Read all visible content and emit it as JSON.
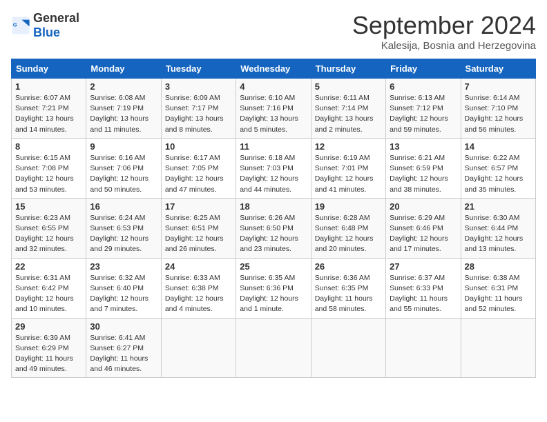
{
  "header": {
    "logo_general": "General",
    "logo_blue": "Blue",
    "month": "September 2024",
    "location": "Kalesija, Bosnia and Herzegovina"
  },
  "weekdays": [
    "Sunday",
    "Monday",
    "Tuesday",
    "Wednesday",
    "Thursday",
    "Friday",
    "Saturday"
  ],
  "weeks": [
    [
      {
        "day": "1",
        "lines": [
          "Sunrise: 6:07 AM",
          "Sunset: 7:21 PM",
          "Daylight: 13 hours",
          "and 14 minutes."
        ]
      },
      {
        "day": "2",
        "lines": [
          "Sunrise: 6:08 AM",
          "Sunset: 7:19 PM",
          "Daylight: 13 hours",
          "and 11 minutes."
        ]
      },
      {
        "day": "3",
        "lines": [
          "Sunrise: 6:09 AM",
          "Sunset: 7:17 PM",
          "Daylight: 13 hours",
          "and 8 minutes."
        ]
      },
      {
        "day": "4",
        "lines": [
          "Sunrise: 6:10 AM",
          "Sunset: 7:16 PM",
          "Daylight: 13 hours",
          "and 5 minutes."
        ]
      },
      {
        "day": "5",
        "lines": [
          "Sunrise: 6:11 AM",
          "Sunset: 7:14 PM",
          "Daylight: 13 hours",
          "and 2 minutes."
        ]
      },
      {
        "day": "6",
        "lines": [
          "Sunrise: 6:13 AM",
          "Sunset: 7:12 PM",
          "Daylight: 12 hours",
          "and 59 minutes."
        ]
      },
      {
        "day": "7",
        "lines": [
          "Sunrise: 6:14 AM",
          "Sunset: 7:10 PM",
          "Daylight: 12 hours",
          "and 56 minutes."
        ]
      }
    ],
    [
      {
        "day": "8",
        "lines": [
          "Sunrise: 6:15 AM",
          "Sunset: 7:08 PM",
          "Daylight: 12 hours",
          "and 53 minutes."
        ]
      },
      {
        "day": "9",
        "lines": [
          "Sunrise: 6:16 AM",
          "Sunset: 7:06 PM",
          "Daylight: 12 hours",
          "and 50 minutes."
        ]
      },
      {
        "day": "10",
        "lines": [
          "Sunrise: 6:17 AM",
          "Sunset: 7:05 PM",
          "Daylight: 12 hours",
          "and 47 minutes."
        ]
      },
      {
        "day": "11",
        "lines": [
          "Sunrise: 6:18 AM",
          "Sunset: 7:03 PM",
          "Daylight: 12 hours",
          "and 44 minutes."
        ]
      },
      {
        "day": "12",
        "lines": [
          "Sunrise: 6:19 AM",
          "Sunset: 7:01 PM",
          "Daylight: 12 hours",
          "and 41 minutes."
        ]
      },
      {
        "day": "13",
        "lines": [
          "Sunrise: 6:21 AM",
          "Sunset: 6:59 PM",
          "Daylight: 12 hours",
          "and 38 minutes."
        ]
      },
      {
        "day": "14",
        "lines": [
          "Sunrise: 6:22 AM",
          "Sunset: 6:57 PM",
          "Daylight: 12 hours",
          "and 35 minutes."
        ]
      }
    ],
    [
      {
        "day": "15",
        "lines": [
          "Sunrise: 6:23 AM",
          "Sunset: 6:55 PM",
          "Daylight: 12 hours",
          "and 32 minutes."
        ]
      },
      {
        "day": "16",
        "lines": [
          "Sunrise: 6:24 AM",
          "Sunset: 6:53 PM",
          "Daylight: 12 hours",
          "and 29 minutes."
        ]
      },
      {
        "day": "17",
        "lines": [
          "Sunrise: 6:25 AM",
          "Sunset: 6:51 PM",
          "Daylight: 12 hours",
          "and 26 minutes."
        ]
      },
      {
        "day": "18",
        "lines": [
          "Sunrise: 6:26 AM",
          "Sunset: 6:50 PM",
          "Daylight: 12 hours",
          "and 23 minutes."
        ]
      },
      {
        "day": "19",
        "lines": [
          "Sunrise: 6:28 AM",
          "Sunset: 6:48 PM",
          "Daylight: 12 hours",
          "and 20 minutes."
        ]
      },
      {
        "day": "20",
        "lines": [
          "Sunrise: 6:29 AM",
          "Sunset: 6:46 PM",
          "Daylight: 12 hours",
          "and 17 minutes."
        ]
      },
      {
        "day": "21",
        "lines": [
          "Sunrise: 6:30 AM",
          "Sunset: 6:44 PM",
          "Daylight: 12 hours",
          "and 13 minutes."
        ]
      }
    ],
    [
      {
        "day": "22",
        "lines": [
          "Sunrise: 6:31 AM",
          "Sunset: 6:42 PM",
          "Daylight: 12 hours",
          "and 10 minutes."
        ]
      },
      {
        "day": "23",
        "lines": [
          "Sunrise: 6:32 AM",
          "Sunset: 6:40 PM",
          "Daylight: 12 hours",
          "and 7 minutes."
        ]
      },
      {
        "day": "24",
        "lines": [
          "Sunrise: 6:33 AM",
          "Sunset: 6:38 PM",
          "Daylight: 12 hours",
          "and 4 minutes."
        ]
      },
      {
        "day": "25",
        "lines": [
          "Sunrise: 6:35 AM",
          "Sunset: 6:36 PM",
          "Daylight: 12 hours",
          "and 1 minute."
        ]
      },
      {
        "day": "26",
        "lines": [
          "Sunrise: 6:36 AM",
          "Sunset: 6:35 PM",
          "Daylight: 11 hours",
          "and 58 minutes."
        ]
      },
      {
        "day": "27",
        "lines": [
          "Sunrise: 6:37 AM",
          "Sunset: 6:33 PM",
          "Daylight: 11 hours",
          "and 55 minutes."
        ]
      },
      {
        "day": "28",
        "lines": [
          "Sunrise: 6:38 AM",
          "Sunset: 6:31 PM",
          "Daylight: 11 hours",
          "and 52 minutes."
        ]
      }
    ],
    [
      {
        "day": "29",
        "lines": [
          "Sunrise: 6:39 AM",
          "Sunset: 6:29 PM",
          "Daylight: 11 hours",
          "and 49 minutes."
        ]
      },
      {
        "day": "30",
        "lines": [
          "Sunrise: 6:41 AM",
          "Sunset: 6:27 PM",
          "Daylight: 11 hours",
          "and 46 minutes."
        ]
      },
      {
        "day": "",
        "lines": []
      },
      {
        "day": "",
        "lines": []
      },
      {
        "day": "",
        "lines": []
      },
      {
        "day": "",
        "lines": []
      },
      {
        "day": "",
        "lines": []
      }
    ]
  ]
}
